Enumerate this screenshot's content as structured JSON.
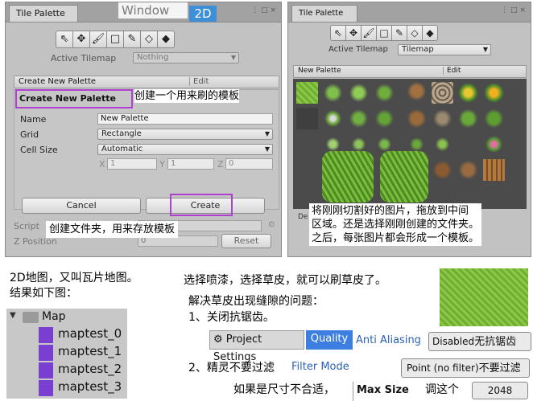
{
  "left_panel": {
    "tab_title": "Tile Palette",
    "menu_overlay": "Window",
    "menu_overlay_2": "2D",
    "window_controls": "⋮ □ ×",
    "tools": [
      "⇖",
      "✥",
      "🖌",
      "□",
      "✎",
      "◇",
      "◆"
    ],
    "active_tilemap_label": "Active Tilemap",
    "active_tilemap_value": "Nothing",
    "palette_dropdown": "Create New Palette",
    "edit_label": "Edit",
    "section_title": "Create New Palette",
    "name_label": "Name",
    "name_value": "New Palette",
    "grid_label": "Grid",
    "grid_value": "Rectangle",
    "cellsize_label": "Cell Size",
    "cellsize_value": "Automatic",
    "x_label": "X",
    "x_value": "1",
    "y_label": "Y",
    "y_value": "1",
    "z_label": "Z",
    "z_value": "0",
    "cancel_label": "Cancel",
    "create_label": "Create",
    "script_label": "Script",
    "zpos_label": "Z Position",
    "zpos_value": "0",
    "reset_label": "Reset",
    "anno_template": "创建一个用来刷的模板",
    "anno_folder": "创建文件夹，用来存放模板"
  },
  "right_panel": {
    "tab_title": "Tile Palette",
    "tools": [
      "⇖",
      "✥",
      "🖌",
      "□",
      "✎",
      "◇",
      "◆"
    ],
    "active_tilemap_label": "Active Tilemap",
    "active_tilemap_value": "Tilemap",
    "palette_dropdown": "New Palette",
    "edit_label": "Edit",
    "anno_lines": [
      "将刚刚切割好的图片，拖放到中间",
      "区域。还是选择刚刚创建的文件夹。",
      "之后，每张图片都会形成一个模板。"
    ],
    "bottom_cutoff": "De"
  },
  "bottom": {
    "left_text_1": "2D地图，又叫瓦片地图。",
    "left_text_2": "结果如下图：",
    "folder_name": "Map",
    "files": [
      "maptest_0",
      "maptest_1",
      "maptest_2",
      "maptest_3"
    ],
    "spray_text": "选择喷漆，选择草皮，就可以刷草皮了。",
    "gap_title": "解决草皮出现缝隙的问题：",
    "step1": "1、关闭抗锯齿。",
    "project_settings": "Project Settings",
    "quality": "Quality",
    "anti_aliasing": "Anti Aliasing",
    "disabled_value": "Disabled",
    "disabled_note": "无抗锯齿",
    "step2": "2、精灵不要过滤",
    "filter_mode": "Filter Mode",
    "point_value": "Point (no filter)",
    "point_note": "不要过滤",
    "size_note": "如果是尺寸不合适，",
    "max_size": "Max Size",
    "adjust_note": "调这个",
    "max_value": "2048"
  }
}
